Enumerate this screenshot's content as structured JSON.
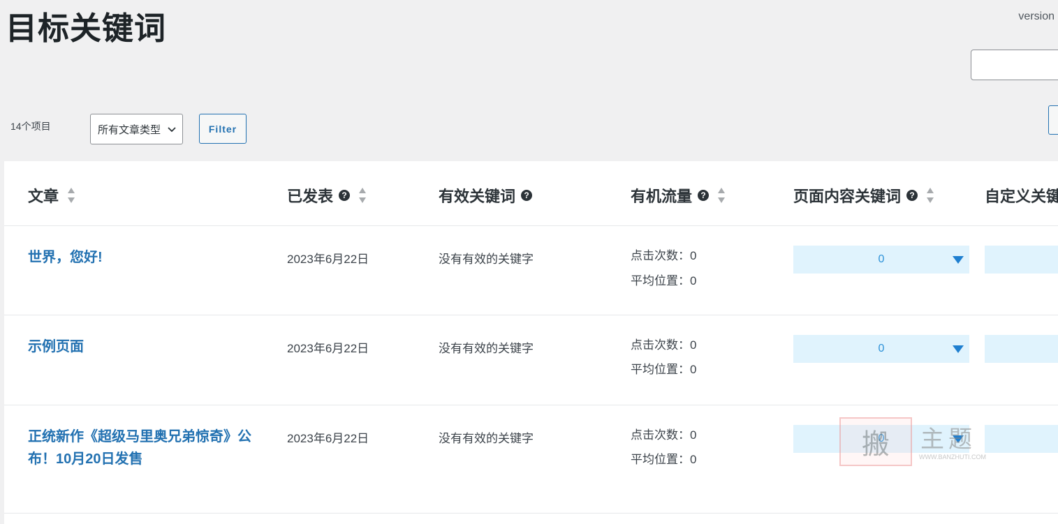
{
  "page": {
    "title": "目标关键词",
    "version_label": "version"
  },
  "toolbar": {
    "item_count": "14个项目",
    "post_type_select": "所有文章类型",
    "filter_label": "Filter"
  },
  "table": {
    "columns": {
      "article": "文章",
      "published": "已发表",
      "valid_keywords": "有效关键词",
      "organic_traffic": "有机流量",
      "page_content_keywords": "页面内容关键词",
      "custom_keywords": "自定义关键"
    },
    "rows": [
      {
        "title": "世界，您好!",
        "date": "2023年6月22日",
        "keywords": "没有有效的关键字",
        "clicks": "点击次数：0",
        "position": "平均位置：0",
        "content_kw": "0"
      },
      {
        "title": "示例页面",
        "date": "2023年6月22日",
        "keywords": "没有有效的关键字",
        "clicks": "点击次数：0",
        "position": "平均位置：0",
        "content_kw": "0"
      },
      {
        "title": "正统新作《超级马里奥兄弟惊奇》公布！10月20日发售",
        "date": "2023年6月22日",
        "keywords": "没有有效的关键字",
        "clicks": "点击次数：0",
        "position": "平均位置：0",
        "content_kw": "0"
      }
    ]
  },
  "watermark": {
    "seal": "搬",
    "text": "主题",
    "url": "WWW.BANZHUTI.COM"
  },
  "colors": {
    "link": "#2271b1",
    "dropdown_bg": "#e0f3fd",
    "background": "#f0f0f1"
  }
}
